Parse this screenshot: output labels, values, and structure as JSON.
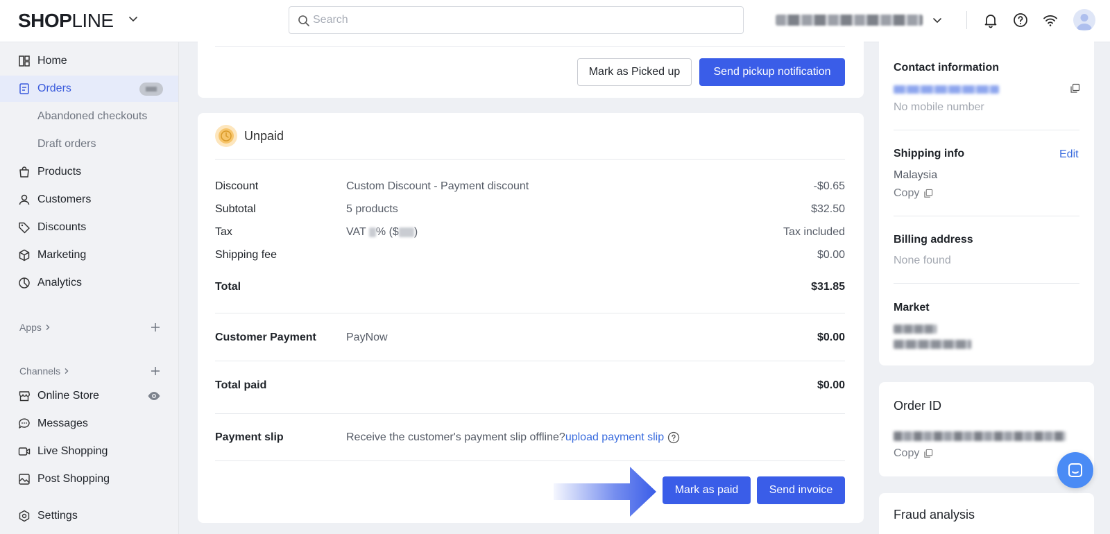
{
  "topbar": {
    "logo_bold": "SHOP",
    "logo_light": "LINE",
    "search_placeholder": "Search"
  },
  "sidebar": {
    "items": [
      {
        "label": "Home",
        "icon": "dashboard-icon"
      },
      {
        "label": "Orders",
        "icon": "orders-icon"
      },
      {
        "label": "Abandoned checkouts"
      },
      {
        "label": "Draft orders"
      },
      {
        "label": "Products",
        "icon": "bag-icon"
      },
      {
        "label": "Customers",
        "icon": "person-icon"
      },
      {
        "label": "Discounts",
        "icon": "tag-icon"
      },
      {
        "label": "Marketing",
        "icon": "cube-icon"
      },
      {
        "label": "Analytics",
        "icon": "pie-chart-icon"
      }
    ],
    "apps_label": "Apps",
    "channels_label": "Channels",
    "channels": [
      {
        "label": "Online Store",
        "icon": "store-icon"
      },
      {
        "label": "Messages",
        "icon": "chat-icon"
      },
      {
        "label": "Live Shopping",
        "icon": "video-icon"
      },
      {
        "label": "Post Shopping",
        "icon": "post-icon"
      }
    ],
    "settings_label": "Settings"
  },
  "fulfillment": {
    "mark_picked_up": "Mark as Picked up",
    "send_pickup_notification": "Send pickup notification"
  },
  "payment": {
    "status": "Unpaid",
    "rows": [
      {
        "label": "Discount",
        "detail": "Custom Discount - Payment discount",
        "amount": "-$0.65"
      },
      {
        "label": "Subtotal",
        "detail": "5 products",
        "amount": "$32.50"
      },
      {
        "label": "Tax",
        "detail_prefix": "VAT ",
        "detail_mid": "% ($",
        "detail_suffix": ")",
        "amount": "Tax included"
      },
      {
        "label": "Shipping fee",
        "detail": "",
        "amount": "$0.00"
      }
    ],
    "total_label": "Total",
    "total_amount": "$31.85",
    "customer_payment_label": "Customer Payment",
    "customer_payment_method": "PayNow",
    "customer_payment_amount": "$0.00",
    "total_paid_label": "Total paid",
    "total_paid_amount": "$0.00",
    "payment_slip_label": "Payment slip",
    "payment_slip_text": "Receive the customer's payment slip offline?",
    "upload_link": "upload payment slip",
    "mark_as_paid": "Mark as paid",
    "send_invoice": "Send invoice"
  },
  "customer_panel": {
    "contact_title": "Contact information",
    "no_mobile": "No mobile number",
    "shipping_title": "Shipping info",
    "edit": "Edit",
    "shipping_country": "Malaysia",
    "copy": "Copy",
    "billing_title": "Billing address",
    "billing_none": "None found",
    "market_title": "Market"
  },
  "order_panel": {
    "title": "Order ID",
    "copy": "Copy"
  },
  "fraud_panel": {
    "title": "Fraud analysis"
  },
  "colors": {
    "primary": "#3a5de8",
    "link": "#3a6cde",
    "unpaid_badge": "#f7c56b"
  }
}
